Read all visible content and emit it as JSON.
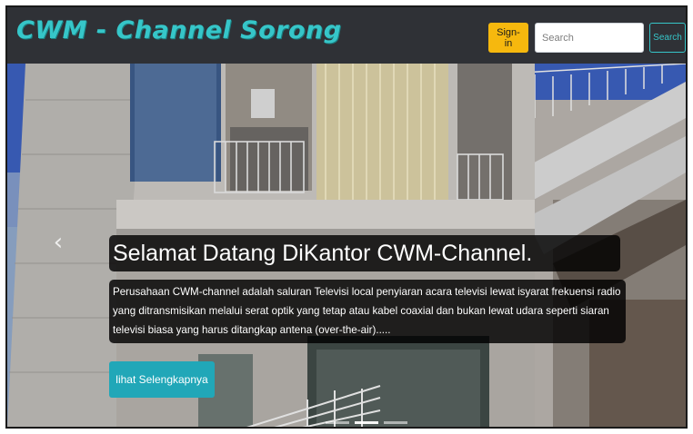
{
  "navbar": {
    "brand": "CWM - Channel Sorong",
    "signin_label": "Sign-in",
    "search_placeholder": "Search",
    "search_button_label": "Search"
  },
  "carousel": {
    "title": "Selamat Datang DiKantor CWM-Channel.",
    "body": "Perusahaan CWM-channel adalah saluran Televisi local penyiaran acara televisi lewat isyarat frekuensi radio yang ditransmisikan melalui serat optik yang tetap atau kabel coaxial dan bukan lewat udara seperti siaran televisi biasa yang harus ditangkap antena (over-the-air).....",
    "button_label": "lihat Selengkapnya",
    "prev_icon": "chevron-left-icon",
    "slide_count": 3,
    "active_slide": 2
  },
  "colors": {
    "navbar_bg": "#2f3136",
    "brand": "#36c6c9",
    "signin_bg": "#f6b80e",
    "search_button": "#36c6c9",
    "more_button_bg": "#21a7b8"
  }
}
